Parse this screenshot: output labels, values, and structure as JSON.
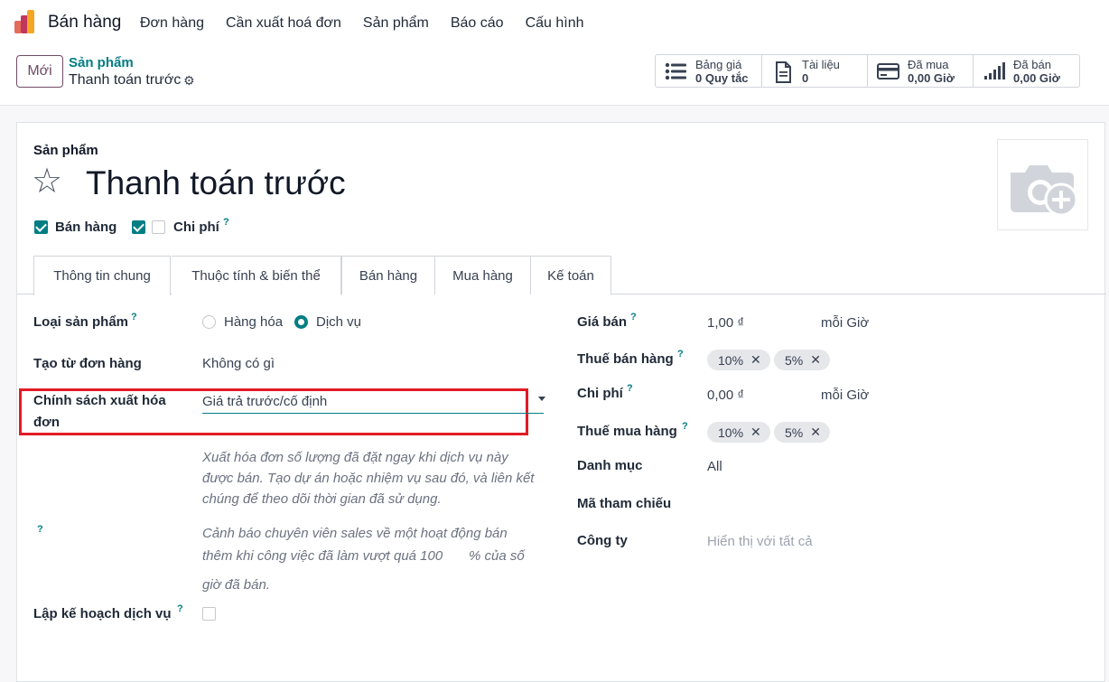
{
  "topnav": {
    "app_name": "Bán hàng",
    "menu": [
      "Đơn hàng",
      "Cần xuất hoá đơn",
      "Sản phẩm",
      "Báo cáo",
      "Cấu hình"
    ]
  },
  "control_panel": {
    "new_button": "Mới",
    "breadcrumb_parent": "Sản phẩm",
    "breadcrumb_current": "Thanh toán trước",
    "smart_buttons": [
      {
        "icon": "list-icon",
        "label": "Bảng giá",
        "value": "0 Quy tắc"
      },
      {
        "icon": "document-icon",
        "label": "Tài liệu",
        "value": "0"
      },
      {
        "icon": "credit-card-icon",
        "label": "Đã mua",
        "value": "0,00 Giờ"
      },
      {
        "icon": "bar-signal-icon",
        "label": "Đã bán",
        "value": "0,00 Giờ"
      }
    ]
  },
  "form": {
    "section_label": "Sản phẩm",
    "title": "Thanh toán trước",
    "checkbox_sale": "Bán hàng",
    "checkbox_expense": "Chi phí",
    "help_mark": "?",
    "tabs": [
      "Thông tin chung",
      "Thuộc tính & biến thể",
      "Bán hàng",
      "Mua hàng",
      "Kế toán"
    ],
    "left": {
      "product_type_label": "Loại sản phẩm",
      "product_type_options": [
        "Hàng hóa",
        "Dịch vụ"
      ],
      "create_from_order_label": "Tạo từ đơn hàng",
      "create_from_order_value": "Không có gì",
      "invoice_policy_label_1": "Chính sách xuất hóa",
      "invoice_policy_label_2": "đơn",
      "invoice_policy_value": "Giá trả trước/cố định",
      "invoice_help_1": "Xuất hóa đơn số lượng đã đặt ngay khi dịch vụ này",
      "invoice_help_2": "được bán. Tạo dự án hoặc nhiệm vụ sau đó, và liên kết",
      "invoice_help_3": "chúng để theo dõi thời gian đã sử dụng.",
      "upsell_help_1": "Cảnh báo chuyên viên sales về một hoạt động bán",
      "upsell_help_2": "thêm khi công việc đã làm vượt quá 100",
      "upsell_help_3": "% của số",
      "upsell_help_4": "giờ đã bán.",
      "plan_service_label": "Lập kế hoạch dịch vụ"
    },
    "right": {
      "sale_price_label": "Giá bán",
      "sale_price_value": "1,00 ₫",
      "sale_price_unit": "mỗi Giờ",
      "sale_tax_label": "Thuế bán hàng",
      "sale_taxes": [
        "10%",
        "5%"
      ],
      "cost_label": "Chi phí",
      "cost_value": "0,00 ₫",
      "cost_unit": "mỗi Giờ",
      "purchase_tax_label": "Thuế mua hàng",
      "purchase_taxes": [
        "10%",
        "5%"
      ],
      "category_label": "Danh mục",
      "category_value": "All",
      "reference_label": "Mã tham chiếu",
      "company_label": "Công ty",
      "company_placeholder": "Hiển thị với tất cả"
    }
  },
  "colors": {
    "primary": "#714b67",
    "accent": "#017e84",
    "highlight": "#e21b24"
  }
}
